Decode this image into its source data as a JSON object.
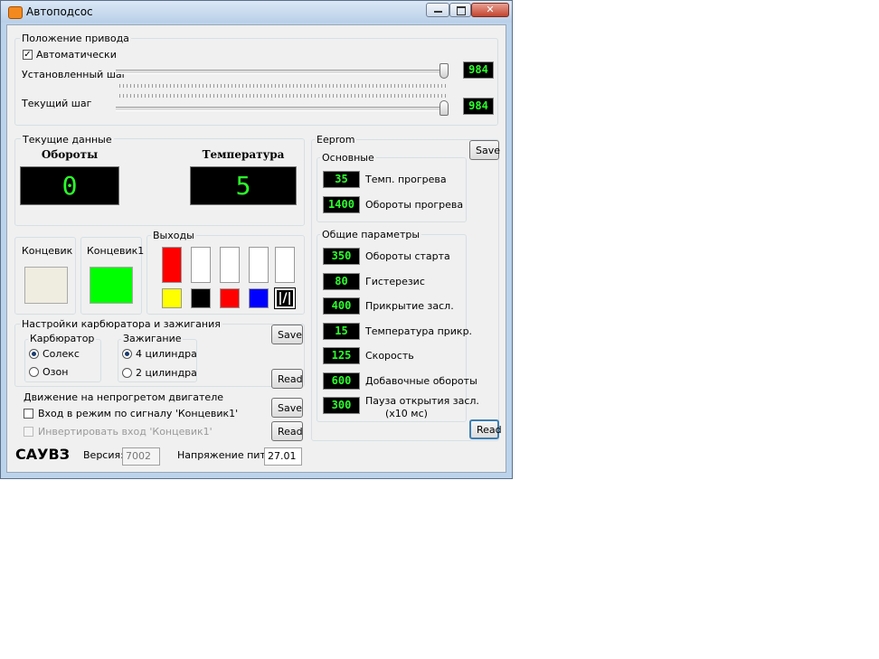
{
  "window": {
    "title": "Автоподсос",
    "minimize": "—",
    "maximize": "□",
    "close": "✕"
  },
  "drive": {
    "group_label": "Положение привода",
    "auto_label": "Автоматически",
    "auto_checked": true,
    "set_step_label": "Установленный шаг",
    "set_step_value": "984",
    "cur_step_label": "Текущий шаг",
    "cur_step_value": "984"
  },
  "current": {
    "group_label": "Текущие данные",
    "rpm_label": "Обороты",
    "rpm_value": "0",
    "temp_label": "Температура",
    "temp_value": "5"
  },
  "switches": {
    "sw1_label": "Концевик",
    "sw1_color": "#efece0",
    "sw2_label": "Концевик1",
    "sw2_color": "#00ff00"
  },
  "outputs": {
    "group_label": "Выходы",
    "top_colors": [
      "#ff0000",
      "#ffffff",
      "#ffffff",
      "#ffffff",
      "#ffffff"
    ],
    "bottom_colors": [
      "#ffff00",
      "#000000",
      "#ff0000",
      "#0000ff",
      "#000000"
    ],
    "last_icon": "slash-sign-icon"
  },
  "carb": {
    "group_label": "Настройки карбюратора и зажигания",
    "carb_label": "Карбюратор",
    "carb_options": [
      "Солекс",
      "Озон"
    ],
    "carb_selected": 0,
    "ign_label": "Зажигание",
    "ign_options": [
      "4 цилиндра",
      "2 цилиндра"
    ],
    "ign_selected": 0,
    "save": "Save",
    "read": "Read"
  },
  "cold": {
    "group_label": "Движение на непрогретом двигателе",
    "enter_label": "Вход в режим по сигналу 'Концевик1'",
    "invert_label": "Инвертировать вход 'Концевик1'",
    "save": "Save",
    "read": "Read"
  },
  "footer": {
    "brand": "САУВЗ",
    "version_label": "Версия:",
    "version_value": "7002",
    "voltage_label": "Напряжение пит.:",
    "voltage_value": "27.01"
  },
  "eeprom": {
    "group_label": "Eeprom",
    "save": "Save",
    "read": "Read",
    "basic_label": "Основные",
    "basic": [
      {
        "value": "35",
        "label": "Темп. прогрева"
      },
      {
        "value": "1400",
        "label": "Обороты прогрева"
      }
    ],
    "general_label": "Общие параметры",
    "general": [
      {
        "value": "350",
        "label": "Обороты старта"
      },
      {
        "value": "80",
        "label": "Гистерезис"
      },
      {
        "value": "400",
        "label": "Прикрытие засл."
      },
      {
        "value": "15",
        "label": "Температура прикр."
      },
      {
        "value": "125",
        "label": "Скорость"
      },
      {
        "value": "600",
        "label": "Добавочные обороты"
      },
      {
        "value": "300",
        "label": "Пауза открытия засл.",
        "label2": "(x10 мс)"
      }
    ]
  },
  "colors": {
    "led_text": "#2bff2b",
    "led_bg": "#000000"
  }
}
